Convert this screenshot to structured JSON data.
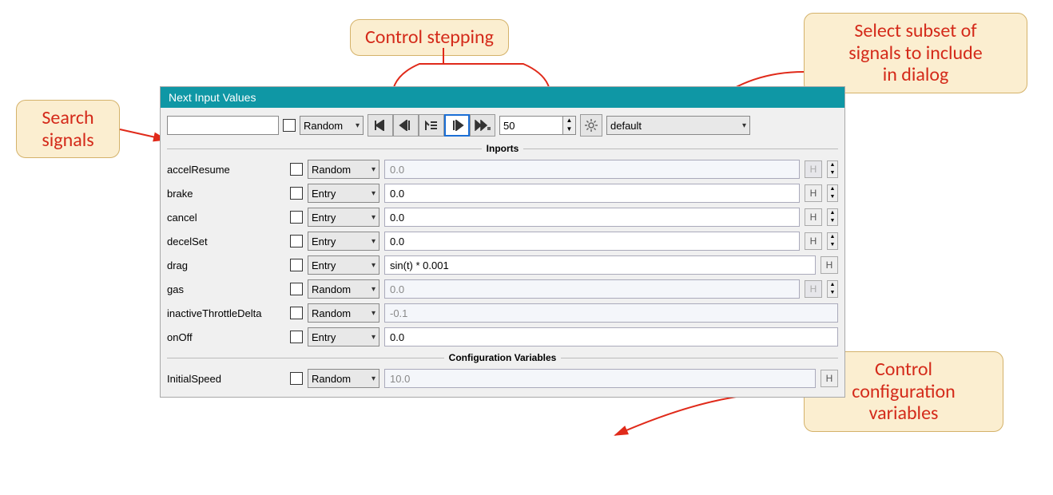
{
  "window": {
    "title": "Next Input Values"
  },
  "toolbar": {
    "search_value": "",
    "mode_label": "Random",
    "step_value": "50",
    "preset_label": "default"
  },
  "sections": {
    "inports_label": "Inports",
    "configvars_label": "Configuration Variables"
  },
  "inports": [
    {
      "name": "accelResume",
      "mode": "Random",
      "value": "0.0",
      "disabled": true,
      "h_disabled": true,
      "has_spin": true
    },
    {
      "name": "brake",
      "mode": "Entry",
      "value": "0.0",
      "disabled": false,
      "h_disabled": false,
      "has_spin": true
    },
    {
      "name": "cancel",
      "mode": "Entry",
      "value": "0.0",
      "disabled": false,
      "h_disabled": false,
      "has_spin": true
    },
    {
      "name": "decelSet",
      "mode": "Entry",
      "value": "0.0",
      "disabled": false,
      "h_disabled": false,
      "has_spin": true
    },
    {
      "name": "drag",
      "mode": "Entry",
      "value": "sin(t) * 0.001",
      "disabled": false,
      "h_disabled": false,
      "has_spin": false
    },
    {
      "name": "gas",
      "mode": "Random",
      "value": "0.0",
      "disabled": true,
      "h_disabled": true,
      "has_spin": true
    },
    {
      "name": "inactiveThrottleDelta",
      "mode": "Random",
      "value": "-0.1",
      "disabled": true,
      "h_disabled": false,
      "has_spin": false,
      "hide_h": true
    },
    {
      "name": "onOff",
      "mode": "Entry",
      "value": "0.0",
      "disabled": false,
      "h_disabled": false,
      "has_spin": false,
      "hide_h": true
    }
  ],
  "configvars": [
    {
      "name": "InitialSpeed",
      "mode": "Random",
      "value": "10.0",
      "disabled": true
    }
  ],
  "callouts": {
    "search": "Search\nsignals",
    "stepping": "Control stepping",
    "subset": "Select subset of\nsignals to include\nin dialog",
    "configvars": "Control\nconfiguration\nvariables"
  },
  "h_label": "H"
}
